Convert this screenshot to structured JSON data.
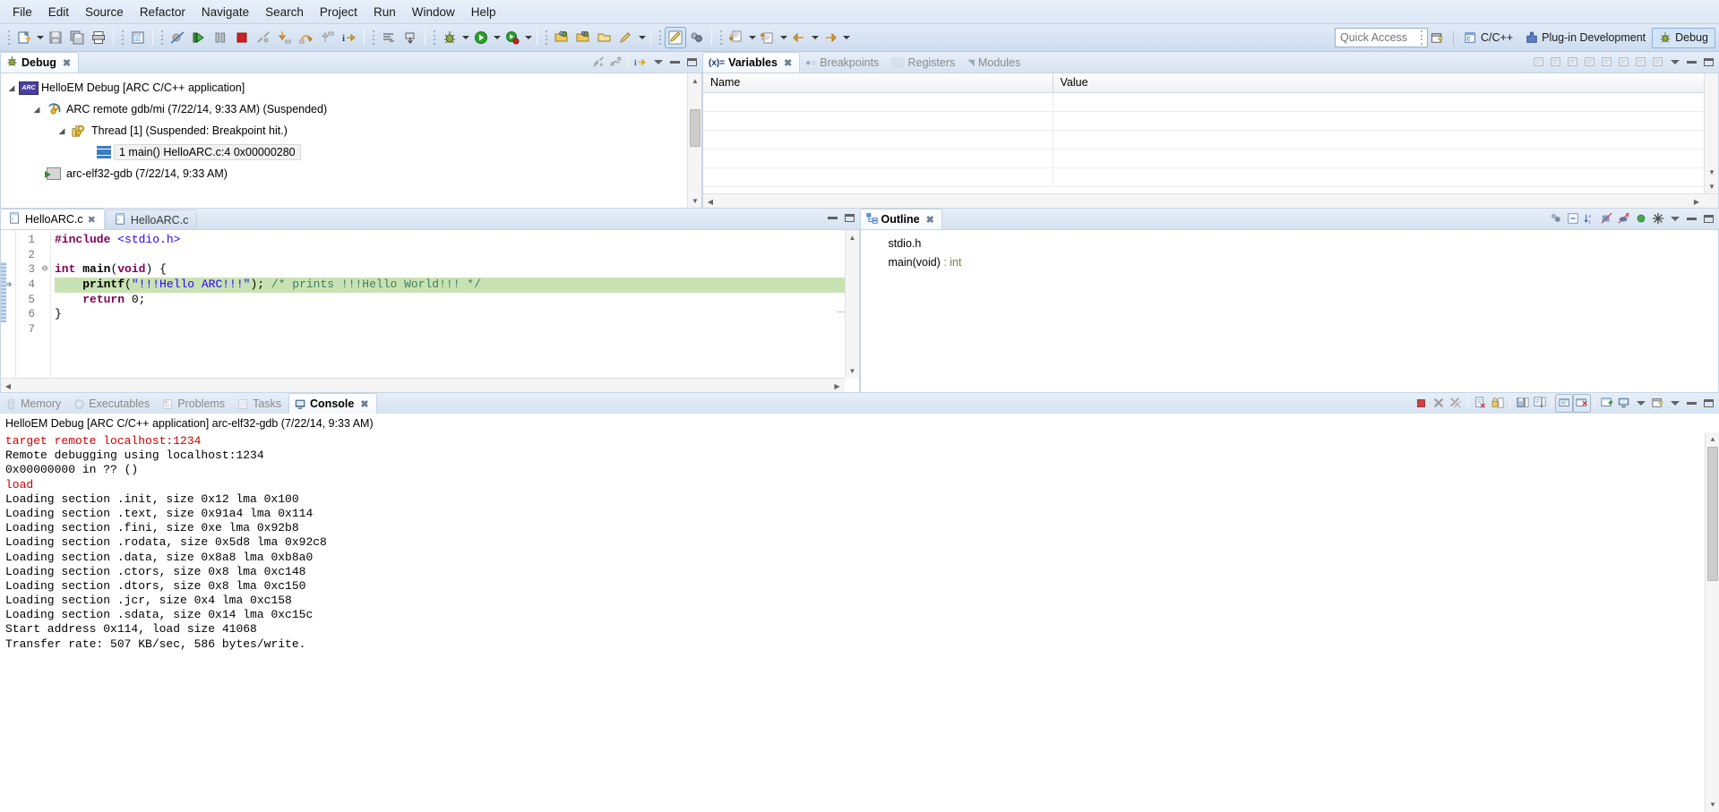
{
  "menubar": {
    "items": [
      "File",
      "Edit",
      "Source",
      "Refactor",
      "Navigate",
      "Search",
      "Project",
      "Run",
      "Window",
      "Help"
    ]
  },
  "toolbar": {
    "groups": [
      {
        "items": [
          {
            "name": "new-icon",
            "glyph": "🗋",
            "dropdown": true
          },
          {
            "name": "save-icon",
            "glyph": "💾",
            "dropdown": false
          },
          {
            "name": "save-all-icon",
            "glyph": "⧉",
            "dropdown": false
          },
          {
            "name": "print-icon",
            "glyph": "🖨",
            "dropdown": false
          }
        ]
      },
      {
        "items": [
          {
            "name": "build-icon",
            "glyph": "⚙",
            "dropdown": false
          }
        ]
      },
      {
        "items": [
          {
            "name": "skip-breakpoints-icon",
            "glyph": "⊘",
            "dropdown": false
          },
          {
            "name": "resume-icon",
            "glyph": "▶",
            "dropdown": false
          },
          {
            "name": "suspend-icon",
            "glyph": "⏸",
            "dropdown": false
          },
          {
            "name": "terminate-icon",
            "glyph": "■",
            "dropdown": false
          },
          {
            "name": "disconnect-icon",
            "glyph": "✂",
            "dropdown": false
          },
          {
            "name": "step-into-icon",
            "glyph": "⤵",
            "dropdown": false
          },
          {
            "name": "step-over-icon",
            "glyph": "↷",
            "dropdown": false
          },
          {
            "name": "step-return-icon",
            "glyph": "⤴",
            "dropdown": false
          },
          {
            "name": "instruction-stepping-icon",
            "glyph": "i⇒",
            "dropdown": false
          }
        ]
      },
      {
        "items": [
          {
            "name": "disassembly-icon",
            "glyph": "≡",
            "dropdown": false
          },
          {
            "name": "drop-to-frame-icon",
            "glyph": "⤓",
            "dropdown": false
          }
        ]
      },
      {
        "items": [
          {
            "name": "debug-icon",
            "glyph": "🐞",
            "dropdown": true
          },
          {
            "name": "run-icon",
            "glyph": "▶",
            "dropdown": true
          },
          {
            "name": "run-last-icon",
            "glyph": "▶",
            "dropdown": true
          }
        ]
      },
      {
        "items": [
          {
            "name": "open-type-icon",
            "glyph": "📂",
            "dropdown": false
          },
          {
            "name": "open-element-icon",
            "glyph": "📂",
            "dropdown": false
          },
          {
            "name": "open-resource-icon",
            "glyph": "📁",
            "dropdown": false
          },
          {
            "name": "edit-icon",
            "glyph": "✎",
            "dropdown": true
          }
        ]
      },
      {
        "items": [
          {
            "name": "toggle-mark-occurrences-icon",
            "glyph": "✎",
            "dropdown": false,
            "pressed": true
          },
          {
            "name": "toggle-block-selection-icon",
            "glyph": "⧉",
            "dropdown": false
          }
        ]
      },
      {
        "items": [
          {
            "name": "previous-annotation-icon",
            "glyph": "⬇",
            "dropdown": true
          },
          {
            "name": "next-annotation-icon",
            "glyph": "⬆",
            "dropdown": true
          },
          {
            "name": "back-icon",
            "glyph": "←",
            "dropdown": true
          },
          {
            "name": "forward-icon",
            "glyph": "→",
            "dropdown": true
          }
        ]
      }
    ],
    "quick_access_placeholder": "Quick Access"
  },
  "perspectives": {
    "open_perspective_tooltip": "Open Perspective",
    "items": [
      {
        "label": "C/C++",
        "icon": "cpp-perspective-icon",
        "active": false
      },
      {
        "label": "Plug-in Development",
        "icon": "plugin-perspective-icon",
        "active": false
      },
      {
        "label": "Debug",
        "icon": "debug-perspective-icon",
        "active": true
      }
    ]
  },
  "debug_view": {
    "tab_label": "Debug",
    "tab_icon": "debug-icon",
    "tools": [
      "disconnect-icon",
      "remove-terminated-icon",
      "instruction-stepping-icon",
      "view-menu-icon",
      "minimize-icon",
      "maximize-icon"
    ],
    "tree": [
      {
        "depth": 0,
        "expanded": true,
        "icon": "arc-launch-icon",
        "label": "HelloEM Debug [ARC C/C++ application]",
        "selected": false
      },
      {
        "depth": 1,
        "expanded": true,
        "icon": "gdb-process-icon",
        "label": "ARC remote gdb/mi (7/22/14, 9:33 AM) (Suspended)",
        "selected": false
      },
      {
        "depth": 2,
        "expanded": true,
        "icon": "thread-icon",
        "label": "Thread [1] (Suspended: Breakpoint hit.)",
        "selected": false
      },
      {
        "depth": 3,
        "expanded": false,
        "icon": "stack-frame-icon",
        "label": "1 main() HelloARC.c:4 0x00000280",
        "selected": true
      },
      {
        "depth": 1,
        "expanded": false,
        "icon": "process-icon",
        "label": "arc-elf32-gdb (7/22/14, 9:33 AM)",
        "selected": false
      }
    ]
  },
  "variables_view": {
    "tabs": [
      {
        "label": "Variables",
        "icon": "variables-icon",
        "active": true,
        "closable": true
      },
      {
        "label": "Breakpoints",
        "icon": "breakpoints-icon",
        "active": false,
        "closable": false
      },
      {
        "label": "Registers",
        "icon": "registers-icon",
        "active": false,
        "closable": false
      },
      {
        "label": "Modules",
        "icon": "modules-icon",
        "active": false,
        "closable": false
      }
    ],
    "columns": [
      "Name",
      "Value"
    ],
    "rows": [],
    "tools": [
      "show-type-names-icon",
      "show-logical-structure-icon",
      "collapse-all-icon",
      "add-watch-icon",
      "remove-selected-icon",
      "remove-all-icon",
      "new-detail-pane-icon",
      "edit-icon",
      "view-menu-icon",
      "minimize-icon",
      "maximize-icon"
    ]
  },
  "editor": {
    "tabs": [
      {
        "label": "HelloARC.c",
        "icon": "c-file-icon",
        "active": false,
        "closable": false
      },
      {
        "label": "HelloARC.c",
        "icon": "c-file-icon",
        "active": true,
        "closable": true
      }
    ],
    "lines": [
      {
        "num": 1,
        "fold": "",
        "highlight": false,
        "breakpoint": false,
        "tokens": [
          {
            "t": "#include ",
            "c": "pp"
          },
          {
            "t": "<stdio.h>",
            "c": "hdr"
          }
        ]
      },
      {
        "num": 2,
        "fold": "",
        "highlight": false,
        "breakpoint": false,
        "tokens": []
      },
      {
        "num": 3,
        "fold": "⊖",
        "highlight": false,
        "breakpoint": false,
        "tokens": [
          {
            "t": "int ",
            "c": "kw"
          },
          {
            "t": "main",
            "c": "b"
          },
          {
            "t": "(",
            "c": "n"
          },
          {
            "t": "void",
            "c": "kw"
          },
          {
            "t": ") {",
            "c": "n"
          }
        ]
      },
      {
        "num": 4,
        "fold": "",
        "highlight": true,
        "breakpoint": true,
        "tokens": [
          {
            "t": "    ",
            "c": "n"
          },
          {
            "t": "printf",
            "c": "b"
          },
          {
            "t": "(",
            "c": "n"
          },
          {
            "t": "\"!!!Hello ARC!!!\"",
            "c": "str"
          },
          {
            "t": "); ",
            "c": "n"
          },
          {
            "t": "/* prints !!!Hello World!!! */",
            "c": "cmt"
          }
        ]
      },
      {
        "num": 5,
        "fold": "",
        "highlight": false,
        "breakpoint": false,
        "tokens": [
          {
            "t": "    ",
            "c": "n"
          },
          {
            "t": "return",
            "c": "kw"
          },
          {
            "t": " 0;",
            "c": "n"
          }
        ]
      },
      {
        "num": 6,
        "fold": "",
        "highlight": false,
        "breakpoint": false,
        "tokens": [
          {
            "t": "}",
            "c": "n"
          }
        ]
      },
      {
        "num": 7,
        "fold": "",
        "highlight": false,
        "breakpoint": false,
        "tokens": []
      }
    ],
    "tools": [
      "minimize-icon",
      "maximize-icon"
    ]
  },
  "outline_view": {
    "tab_label": "Outline",
    "tab_icon": "outline-icon",
    "tools": [
      "sort-group-icon",
      "collapse-all-icon",
      "sort-icon",
      "hide-fields-icon",
      "hide-static-icon",
      "hide-nonpublic-icon",
      "hide-macros-icon",
      "view-menu-icon",
      "minimize-icon",
      "maximize-icon"
    ],
    "items": [
      {
        "icon": "include-icon",
        "label": "stdio.h",
        "type": ""
      },
      {
        "icon": "function-icon",
        "label": "main(void)",
        "type": " : int"
      }
    ]
  },
  "console_view": {
    "tabs": [
      {
        "label": "Console",
        "icon": "console-icon",
        "active": true,
        "closable": true
      },
      {
        "label": "Tasks",
        "icon": "tasks-icon",
        "active": false,
        "closable": false
      },
      {
        "label": "Problems",
        "icon": "problems-icon",
        "active": false,
        "closable": false
      },
      {
        "label": "Executables",
        "icon": "executables-icon",
        "active": false,
        "closable": false
      },
      {
        "label": "Memory",
        "icon": "memory-icon",
        "active": false,
        "closable": false
      }
    ],
    "header": "HelloEM Debug [ARC C/C++ application] arc-elf32-gdb (7/22/14, 9:33 AM)",
    "tools": [
      "terminate-icon",
      "remove-launch-icon",
      "remove-all-terminated-icon",
      "clear-console-icon",
      "scroll-lock-icon",
      "save-console-icon",
      "word-wrap-icon",
      "show-console-on-output-icon",
      "show-console-on-error-icon",
      "pin-console-icon",
      "display-selected-console-icon",
      "open-console-icon",
      "minimize-icon",
      "maximize-icon"
    ],
    "lines": [
      {
        "text": "target remote localhost:1234",
        "color": "red"
      },
      {
        "text": "Remote debugging using localhost:1234",
        "color": "black"
      },
      {
        "text": "0x00000000 in ?? ()",
        "color": "black"
      },
      {
        "text": "load",
        "color": "red"
      },
      {
        "text": "Loading section .init, size 0x12 lma 0x100",
        "color": "black"
      },
      {
        "text": "Loading section .text, size 0x91a4 lma 0x114",
        "color": "black"
      },
      {
        "text": "Loading section .fini, size 0xe lma 0x92b8",
        "color": "black"
      },
      {
        "text": "Loading section .rodata, size 0x5d8 lma 0x92c8",
        "color": "black"
      },
      {
        "text": "Loading section .data, size 0x8a8 lma 0xb8a0",
        "color": "black"
      },
      {
        "text": "Loading section .ctors, size 0x8 lma 0xc148",
        "color": "black"
      },
      {
        "text": "Loading section .dtors, size 0x8 lma 0xc150",
        "color": "black"
      },
      {
        "text": "Loading section .jcr, size 0x4 lma 0xc158",
        "color": "black"
      },
      {
        "text": "Loading section .sdata, size 0x14 lma 0xc15c",
        "color": "black"
      },
      {
        "text": "Start address 0x114, load size 41068",
        "color": "black"
      },
      {
        "text": "Transfer rate: 507 KB/sec, 586 bytes/write.",
        "color": "black"
      }
    ]
  },
  "colors": {
    "accent": "#3c7cc0",
    "breakpoint_line": "#c9e2b3",
    "console_error": "#cc0000",
    "keyword": "#7f0055",
    "string": "#2a00ff",
    "comment": "#3f7f5f"
  }
}
